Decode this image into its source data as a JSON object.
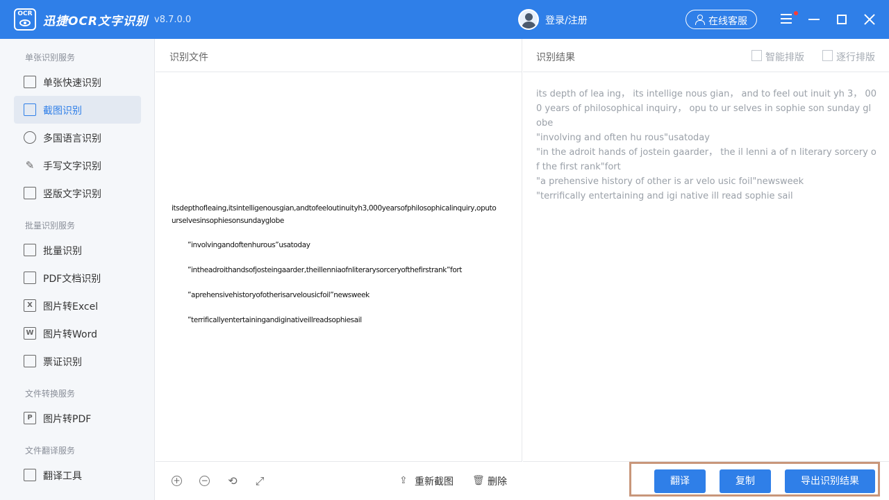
{
  "app": {
    "logo_text": "OCR",
    "name": "迅捷OCR文字识别",
    "version": "v8.7.0.0",
    "accent": "#2f7fe8"
  },
  "header": {
    "login": "登录/注册",
    "service": "在线客服"
  },
  "sidebar": {
    "groups": [
      {
        "title": "单张识别服务"
      },
      {
        "title": "批量识别服务"
      },
      {
        "title": "文件转换服务"
      },
      {
        "title": "文件翻译服务"
      }
    ],
    "items": [
      {
        "label": "单张快速识别"
      },
      {
        "label": "截图识别"
      },
      {
        "label": "多国语言识别"
      },
      {
        "label": "手写文字识别"
      },
      {
        "label": "竖版文字识别"
      },
      {
        "label": "批量识别"
      },
      {
        "label": "PDF文档识别"
      },
      {
        "label": "图片转Excel"
      },
      {
        "label": "图片转Word"
      },
      {
        "label": "票证识别"
      },
      {
        "label": "图片转PDF"
      },
      {
        "label": "翻译工具"
      }
    ],
    "active": "截图识别"
  },
  "file_panel": {
    "title": "识别文件",
    "lines": [
      "itsdepthofleaing,itsintelligenousgian,andtofeeloutinuityh3,000yearsofphilosophicalinquiry,oputo urselvesinsophiesonsundayglobe",
      "”involvingandoftenhurous”usatoday",
      "”intheadroithandsofjosteingaarder,theillenniaofnliterarysorceryofthefirstrank”fort",
      "”aprehensivehistoryofotherisarvelousicfoil”newsweek",
      "”terrificallyentertainingandiginativeillreadsophiesail"
    ],
    "recapture": "重新截图",
    "delete": "删除"
  },
  "result_panel": {
    "title": "识别结果",
    "smart_layout": "智能排版",
    "line_layout": "逐行排版",
    "lines": [
      "its depth of lea ing， its intellige nous gian， and to feel out inuit yh 3， 000 years of philosophical inquiry， opu to ur selves in sophie son sunday globe",
      "\"involving and often hu rous\"usatoday",
      "\"in the adroit hands of jostein gaarder， the il lenni a of n literary sorcery of the first rank\"fort",
      "\"a prehensive history of other is ar velo usic foil\"newsweek",
      "\"terrifically entertaining and igi native ill read sophie sail"
    ]
  },
  "actions": {
    "translate": "翻译",
    "copy": "复制",
    "export": "导出识别结果"
  }
}
